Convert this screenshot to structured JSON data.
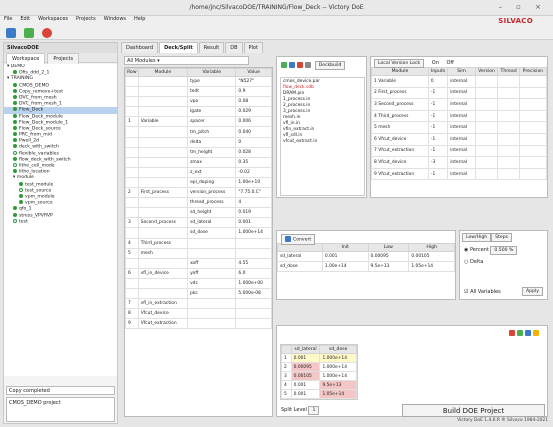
{
  "window": {
    "title": "/home/jnc/SilvacoDOE/TRAINING/Flow_Deck -- Victory DoE"
  },
  "menu": [
    "File",
    "Edit",
    "Workspaces",
    "Projects",
    "Windows",
    "Help"
  ],
  "brand": "SILVACO",
  "left": {
    "header": "SilvacoDOE",
    "tabs": [
      "Workspace",
      "Projects"
    ],
    "tree": [
      {
        "label": "DEMO",
        "indent": 0,
        "color": ""
      },
      {
        "label": "Ofis_ddd_2_1",
        "indent": 1,
        "color": "#2d9c3a"
      },
      {
        "label": "TRAINING",
        "indent": 0,
        "color": ""
      },
      {
        "label": "CMOS_DEMO",
        "indent": 1,
        "color": "#2d9c3a"
      },
      {
        "label": "Copy_remove+test",
        "indent": 1,
        "color": "#2d9c3a"
      },
      {
        "label": "DVC_from_mesh",
        "indent": 1,
        "color": "#2d9c3a"
      },
      {
        "label": "DVC_from_mesh_1",
        "indent": 1,
        "color": "#2d9c3a"
      },
      {
        "label": "Flow_Deck",
        "indent": 1,
        "color": "#2d9c3a",
        "sel": true
      },
      {
        "label": "Flow_Deck_module",
        "indent": 1,
        "color": "#2d9c3a"
      },
      {
        "label": "Flow_Deck_module_1",
        "indent": 1,
        "color": "#2d9c3a"
      },
      {
        "label": "Flow_Deck_source",
        "indent": 1,
        "color": "#2d9c3a"
      },
      {
        "label": "PRC_from_mid",
        "indent": 1,
        "color": "#2d9c3a"
      },
      {
        "label": "Pwell_2d",
        "indent": 1,
        "color": "#2d9c3a"
      },
      {
        "label": "deck_with_switch",
        "indent": 1,
        "color": "#2d9c3a"
      },
      {
        "label": "flexible_variables",
        "indent": 1,
        "color": "#ffffff"
      },
      {
        "label": "flow_deck_with_switch",
        "indent": 1,
        "color": "#2d9c3a"
      },
      {
        "label": "lithe_cell_mode",
        "indent": 1,
        "color": "#ffffff"
      },
      {
        "label": "litho_location",
        "indent": 1,
        "color": "#2d9c3a"
      },
      {
        "label": "module",
        "indent": 1,
        "color": ""
      },
      {
        "label": "test_module",
        "indent": 2,
        "color": "#2d9c3a"
      },
      {
        "label": "test_source",
        "indent": 2,
        "color": "#ffffff"
      },
      {
        "label": "vpm_module",
        "indent": 2,
        "color": "#2d9c3a"
      },
      {
        "label": "vpm_source",
        "indent": 2,
        "color": "#2d9c3a"
      },
      {
        "label": "qfo_1",
        "indent": 1,
        "color": "#2d9c3a"
      },
      {
        "label": "stress_VPVRVP",
        "indent": 1,
        "color": "#2d9c3a"
      },
      {
        "label": "test",
        "indent": 1,
        "color": "#ffffff"
      }
    ],
    "status": "Copy completed",
    "message": "CMOS_DEMO project"
  },
  "main": {
    "tabs": [
      "Dashboard",
      "Deck/Split",
      "Result",
      "DB",
      "Plot"
    ],
    "active_tab": 1,
    "module_filter": "All Modules",
    "columns": [
      "Row",
      "Module",
      "Variable",
      "Value"
    ],
    "rows": [
      [
        "",
        "",
        "type",
        "\"N527\""
      ],
      [
        "",
        "",
        "tedt",
        "0.9"
      ],
      [
        "",
        "",
        "vpo",
        "0.08"
      ],
      [
        "",
        "",
        "lgate",
        "0.029"
      ],
      [
        "1",
        "Variable",
        "spacer",
        "0.006"
      ],
      [
        "",
        "",
        "tm_pitch",
        "0.040"
      ],
      [
        "",
        "",
        "delta",
        "0"
      ],
      [
        "",
        "",
        "tm_height",
        "0.028"
      ],
      [
        "",
        "",
        "zmax",
        "0.35"
      ],
      [
        "",
        "",
        "z_ext",
        "-0.02"
      ],
      [
        "",
        "",
        "epi_doping",
        "1.00e+10"
      ],
      [
        "2",
        "First_process",
        "version_process",
        "\"7.75.0.C\""
      ],
      [
        "",
        "",
        "thread_process",
        "4"
      ],
      [
        "",
        "",
        "sd_height",
        "0.019"
      ],
      [
        "3",
        "Second_process",
        "sd_lateral",
        "0.001"
      ],
      [
        "",
        "",
        "sd_dose",
        "1.000e+14"
      ],
      [
        "4",
        "Third_process",
        "",
        ""
      ],
      [
        "5",
        "mesh",
        "",
        ""
      ],
      [
        "",
        "",
        "xoff",
        "4.55"
      ],
      [
        "6",
        "vfl_in_device",
        "yoff",
        "6.0"
      ],
      [
        "",
        "",
        "vdc",
        "1.000e+00"
      ],
      [
        "",
        "",
        "pkc",
        "5.000e-08"
      ],
      [
        "7",
        "vfl_in_extraction",
        "",
        ""
      ],
      [
        "8",
        "Vfcut_device",
        "",
        ""
      ],
      [
        "9",
        "Vfcut_extraction",
        "",
        ""
      ]
    ],
    "deck_button": "Deckbuild",
    "files": [
      "cmos_device.par",
      "flow_deck.sdb",
      "DRAM.pin",
      "1_process.in",
      "2_process.in",
      "3_process.in",
      "mesh.in",
      "vfl_in.in",
      "vfin_extract.in",
      "vfl_sdl.in",
      "vfcut_extract.in"
    ],
    "version": {
      "title": "Local Version Lock",
      "on": "On",
      "off": "Off",
      "columns": [
        "Module",
        "Inputs",
        "Sim",
        "Version",
        "Thread",
        "Precision"
      ],
      "rows": [
        [
          "1 Variable",
          "0",
          "internal"
        ],
        [
          "2 First_process",
          "-1",
          "internal"
        ],
        [
          "3 Second_process",
          "-1",
          "internal"
        ],
        [
          "4 Third_process",
          "-1",
          "internal"
        ],
        [
          "5 mesh",
          "-1",
          "internal"
        ],
        [
          "6 Vfcut_device",
          "-1",
          "internal"
        ],
        [
          "7 Vfcut_extraction",
          "-1",
          "internal"
        ],
        [
          "8 Vfcut_device",
          "-3",
          "internal"
        ],
        [
          "9 Vfcut_extraction",
          "-1",
          "internal"
        ]
      ]
    },
    "convert_button": "Convert",
    "split": {
      "columns": [
        "",
        "Init",
        "Low",
        "High"
      ],
      "rows": [
        [
          "sd_lateral",
          "0.001",
          "0.00095",
          "0.00105"
        ],
        [
          "sd_dose",
          "1.00e+14",
          "9.5e+13",
          "1.05e+14"
        ]
      ]
    },
    "lowhigh": {
      "tabs": [
        "Low/High",
        "Steps"
      ],
      "percent_label": "Percent",
      "percent_value": "0.500 %",
      "delta_label": "Delta",
      "all_vars": "All Variables",
      "apply": "Apply"
    },
    "doe": {
      "columns": [
        "sd_lateral",
        "sd_dose"
      ],
      "rows": [
        [
          "1",
          "0.001",
          "1.000e+14"
        ],
        [
          "2",
          "0.00095",
          "1.000e+14"
        ],
        [
          "3",
          "0.00105",
          "1.000e+14"
        ],
        [
          "4",
          "0.001",
          "9.5e+13"
        ],
        [
          "5",
          "0.001",
          "1.05e+14"
        ]
      ],
      "split_level_label": "Split Level",
      "split_level": "1",
      "build": "Build DOE Project"
    },
    "statusbar": "Victory DoE 1.4.6.R  ® Silvaco 1984-2021"
  }
}
